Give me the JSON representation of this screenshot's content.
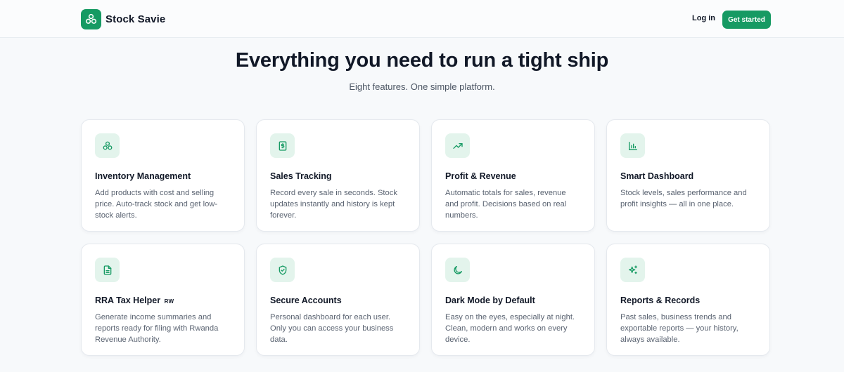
{
  "header": {
    "brand_name": "Stock Savie",
    "login_label": "Log in",
    "cta_label": "Get started"
  },
  "hero": {
    "title": "Everything you need to run a tight ship",
    "subtitle": "Eight features. One simple platform."
  },
  "colors": {
    "accent": "#169a63",
    "icon_bg": "#e3f4ec",
    "page_bg": "#f7f9fb"
  },
  "features": [
    {
      "icon": "inventory-icon",
      "title": "Inventory Management",
      "tag": "",
      "desc": "Add products with cost and selling price. Auto-track stock and get low-stock alerts."
    },
    {
      "icon": "receipt-icon",
      "title": "Sales Tracking",
      "tag": "",
      "desc": "Record every sale in seconds. Stock updates instantly and history is kept forever."
    },
    {
      "icon": "trending-up-icon",
      "title": "Profit & Revenue",
      "tag": "",
      "desc": "Automatic totals for sales, revenue and profit. Decisions based on real numbers."
    },
    {
      "icon": "bar-chart-icon",
      "title": "Smart Dashboard",
      "tag": "",
      "desc": "Stock levels, sales performance and profit insights — all in one place."
    },
    {
      "icon": "document-icon",
      "title": "RRA Tax Helper",
      "tag": "RW",
      "desc": "Generate income summaries and reports ready for filing with Rwanda Revenue Authority."
    },
    {
      "icon": "shield-check-icon",
      "title": "Secure Accounts",
      "tag": "",
      "desc": "Personal dashboard for each user. Only you can access your business data."
    },
    {
      "icon": "moon-icon",
      "title": "Dark Mode by Default",
      "tag": "",
      "desc": "Easy on the eyes, especially at night. Clean, modern and works on every device."
    },
    {
      "icon": "sparkles-icon",
      "title": "Reports & Records",
      "tag": "",
      "desc": "Past sales, business trends and exportable reports — your history, always available."
    }
  ]
}
